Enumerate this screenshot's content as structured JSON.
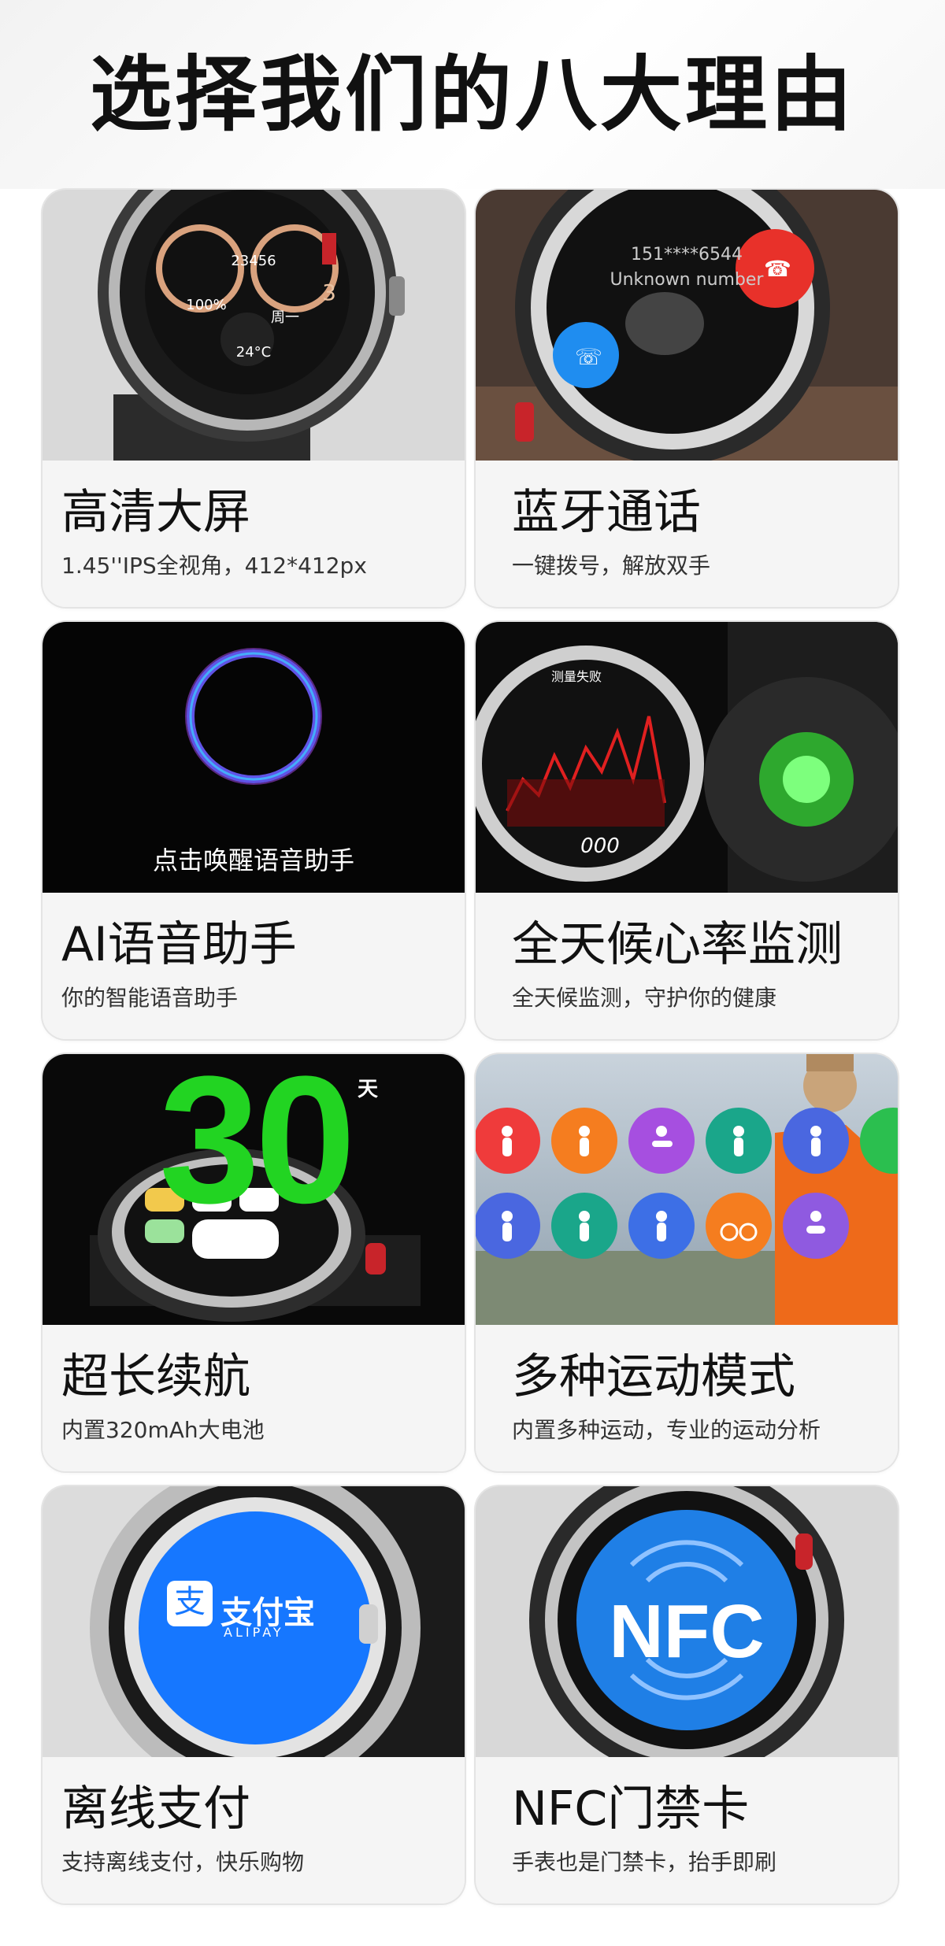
{
  "page": {
    "title": "选择我们的八大理由"
  },
  "cards": [
    {
      "id": "hd-screen",
      "title": "高清大屏",
      "subtitle": "1.45''IPS全视角，412*412px",
      "watch_face": {
        "steps": "23456",
        "battery": "100%",
        "weekday": "周一",
        "temp": "24°C",
        "hour_mark": "3"
      }
    },
    {
      "id": "bt-call",
      "title": "蓝牙通话",
      "subtitle": "一键拨号，解放双手",
      "call_screen": {
        "number": "151****6544",
        "label": "Unknown number"
      }
    },
    {
      "id": "ai-voice",
      "title": "AI语音助手",
      "subtitle": "你的智能语音助手",
      "overlay": "点击唤醒语音助手"
    },
    {
      "id": "heart-rate",
      "title": "全天候心率监测",
      "subtitle": "全天候监测，守护你的健康",
      "hr_screen": {
        "label": "测量失败",
        "value": "000"
      }
    },
    {
      "id": "battery",
      "title": "超长续航",
      "subtitle": "内置320mAh大电池",
      "big_number": "30",
      "unit": "天"
    },
    {
      "id": "sports",
      "title": "多种运动模式",
      "subtitle": "内置多种运动，专业的运动分析"
    },
    {
      "id": "offline-pay",
      "title": "离线支付",
      "subtitle": "支持离线支付，快乐购物",
      "pay": {
        "brand": "支付宝",
        "sub": "ALIPAY"
      }
    },
    {
      "id": "nfc",
      "title": "NFC门禁卡",
      "subtitle": "手表也是门禁卡，抬手即刷",
      "nfc_label": "NFC"
    }
  ],
  "colors": {
    "alipay": "#1677ff",
    "nfc": "#1f7fe6",
    "call_red": "#e8312a",
    "call_blue": "#1f8df0",
    "green": "#22d422"
  }
}
